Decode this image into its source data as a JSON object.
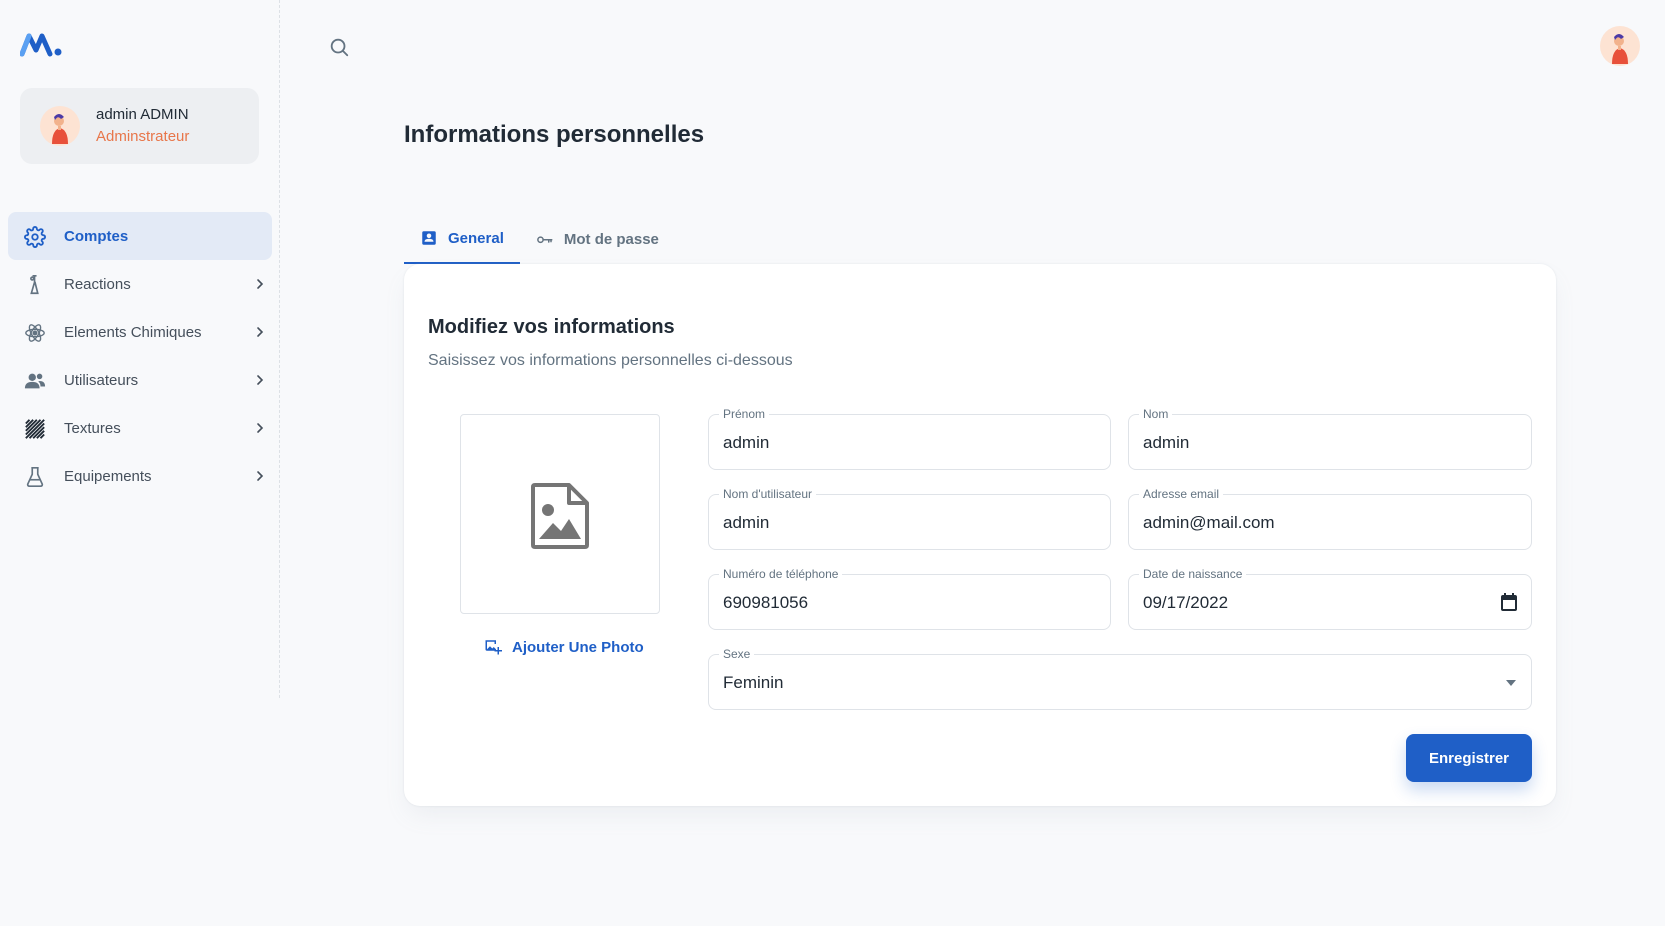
{
  "user": {
    "name": "admin ADMIN",
    "role": "Adminstrateur"
  },
  "nav": [
    {
      "label": "Comptes",
      "icon": "gear-icon",
      "active": true,
      "chevron": false
    },
    {
      "label": "Reactions",
      "icon": "flask-stand-icon",
      "active": false,
      "chevron": true
    },
    {
      "label": "Elements Chimiques",
      "icon": "atom-icon",
      "active": false,
      "chevron": true
    },
    {
      "label": "Utilisateurs",
      "icon": "users-icon",
      "active": false,
      "chevron": true
    },
    {
      "label": "Textures",
      "icon": "texture-icon",
      "active": false,
      "chevron": true
    },
    {
      "label": "Equipements",
      "icon": "beaker-icon",
      "active": false,
      "chevron": true
    }
  ],
  "page": {
    "title": "Informations personnelles"
  },
  "tabs": [
    {
      "label": "General",
      "icon": "contact-card-icon",
      "active": true
    },
    {
      "label": "Mot de passe",
      "icon": "key-icon",
      "active": false
    }
  ],
  "form": {
    "title": "Modifiez vos informations",
    "subtitle": "Saisissez vos informations personnelles ci-dessous",
    "add_photo": "Ajouter Une Photo",
    "fields": {
      "prenom": {
        "label": "Prénom",
        "value": "admin"
      },
      "nom": {
        "label": "Nom",
        "value": "admin"
      },
      "username": {
        "label": "Nom d'utilisateur",
        "value": "admin"
      },
      "email": {
        "label": "Adresse email",
        "value": "admin@mail.com"
      },
      "phone": {
        "label": "Numéro de téléphone",
        "value": "690981056"
      },
      "birthdate": {
        "label": "Date de naissance",
        "value": "09/17/2022"
      },
      "sexe": {
        "label": "Sexe",
        "value": "Feminin"
      }
    },
    "save_label": "Enregistrer"
  },
  "colors": {
    "primary": "#1f5fc7",
    "role": "#e8764a",
    "nav_active_bg": "#e3eaf6"
  }
}
